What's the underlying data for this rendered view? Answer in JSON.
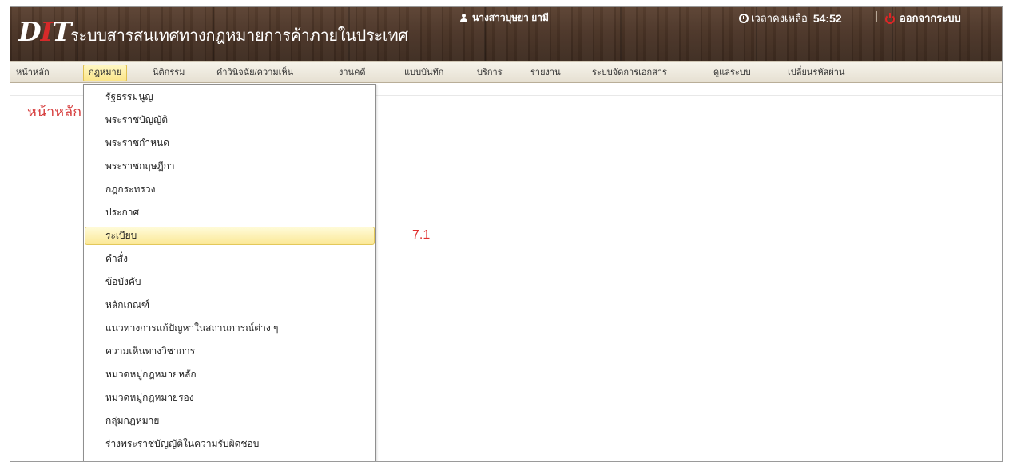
{
  "header": {
    "logo_main": "D",
    "logo_accent": "I",
    "logo_end": "T",
    "site_title": "ระบบสารสนเทศทางกฎหมายการค้าภายในประเทศ",
    "user_name": "นางสาวบุษยา ยามี",
    "timer_label": "เวลาคงเหลือ",
    "timer_value": "54:52",
    "logout_label": "ออกจากระบบ"
  },
  "nav": {
    "items": [
      {
        "label": "หน้าหลัก"
      },
      {
        "label": "กฎหมาย"
      },
      {
        "label": "นิติกรรม"
      },
      {
        "label": "คำวินิจฉัย/ความเห็น"
      },
      {
        "label": "งานคดี"
      },
      {
        "label": "แบบบันทึก"
      },
      {
        "label": "บริการ"
      },
      {
        "label": "รายงาน"
      },
      {
        "label": "ระบบจัดการเอกสาร"
      },
      {
        "label": "ดูแลระบบ"
      },
      {
        "label": "เปลี่ยนรหัสผ่าน"
      }
    ],
    "active": "กฎหมาย"
  },
  "page": {
    "heading": "หน้าหลัก"
  },
  "dropdown": {
    "items": [
      {
        "label": "รัฐธรรมนูญ"
      },
      {
        "label": "พระราชบัญญัติ"
      },
      {
        "label": "พระราชกำหนด"
      },
      {
        "label": "พระราชกฤษฎีกา"
      },
      {
        "label": "กฎกระทรวง"
      },
      {
        "label": "ประกาศ"
      },
      {
        "label": "ระเบียบ"
      },
      {
        "label": "คำสั่ง"
      },
      {
        "label": "ข้อบังคับ"
      },
      {
        "label": "หลักเกณฑ์"
      },
      {
        "label": "แนวทางการแก้ปัญหาในสถานการณ์ต่าง ๆ"
      },
      {
        "label": "ความเห็นทางวิชาการ"
      },
      {
        "label": "หมวดหมู่กฎหมายหลัก"
      },
      {
        "label": "หมวดหมู่กฎหมายรอง"
      },
      {
        "label": "กลุ่มกฎหมาย"
      },
      {
        "label": "ร่างพระราชบัญญัติในความรับผิดชอบ"
      }
    ],
    "highlighted": "ระเบียบ"
  },
  "annotation": "7.1",
  "colors": {
    "accent_red": "#d63c3c",
    "highlight_yellow": "#fbe896",
    "header_brown": "#4a3426"
  }
}
